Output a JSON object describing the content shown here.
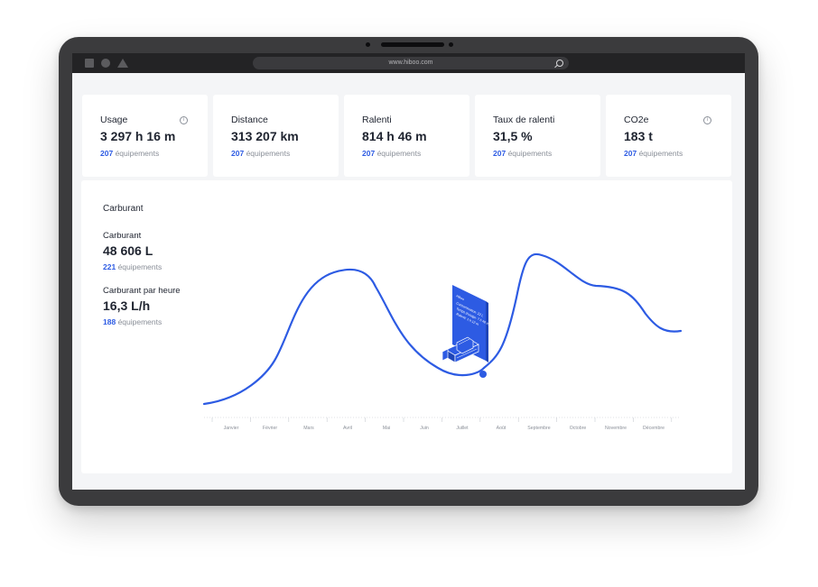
{
  "browser": {
    "url": "www.hiboo.com"
  },
  "cards": [
    {
      "label": "Usage",
      "value": "3 297 h  16 m",
      "count": "207",
      "unit": "équipements",
      "info": true
    },
    {
      "label": "Distance",
      "value": "313 207 km",
      "count": "207",
      "unit": "équipements",
      "info": false
    },
    {
      "label": "Ralenti",
      "value": "814 h  46 m",
      "count": "207",
      "unit": "équipements",
      "info": false
    },
    {
      "label": "Taux de ralenti",
      "value": "31,5 %",
      "count": "207",
      "unit": "équipements",
      "info": false
    },
    {
      "label": "CO2e",
      "value": "183 t",
      "count": "207",
      "unit": "équipements",
      "info": true
    }
  ],
  "fuel_panel": {
    "title": "Carburant",
    "metrics": [
      {
        "label": "Carburant",
        "value": "48 606 L",
        "count": "221",
        "unit": "équipements"
      },
      {
        "label": "Carburant par heure",
        "value": "16,3 L/h",
        "count": "188",
        "unit": "équipements"
      }
    ],
    "months": [
      "Janvier",
      "Février",
      "Mars",
      "Avril",
      "Mai",
      "Juin",
      "Juillet",
      "Août",
      "Septembre",
      "Octobre",
      "Novembre",
      "Décembre"
    ],
    "callout_lines": [
      "Hiboo",
      "Consommation: 22 L",
      "Temps d'usage: 7 h 46 m",
      "Ralenti: 1 h 12 m"
    ]
  },
  "colors": {
    "accent": "#2d5be3",
    "frame": "#3b3b3d",
    "browser_bar": "#232325",
    "screen_bg": "#f4f5f7"
  }
}
